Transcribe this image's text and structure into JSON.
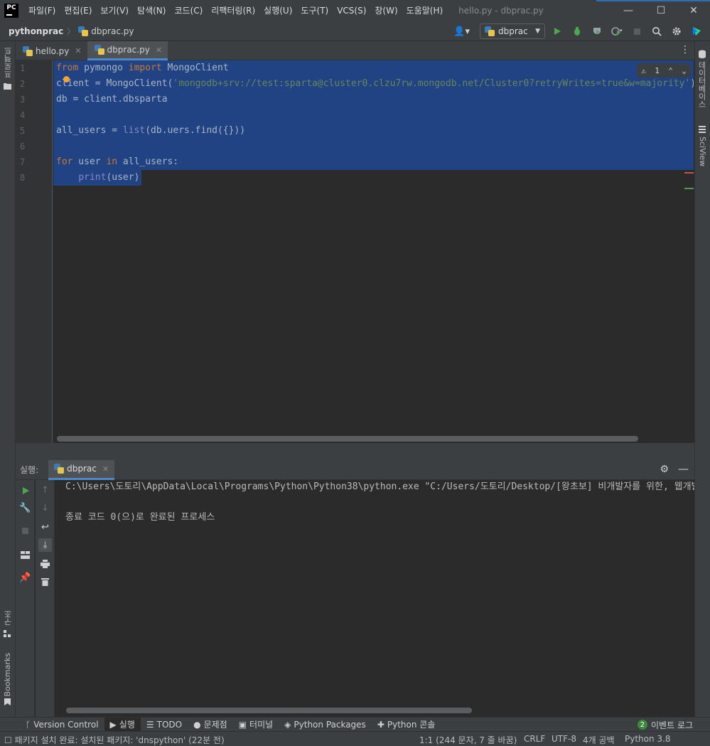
{
  "app": {
    "logo_text": "PC",
    "window_title": "hello.py - dbprac.py"
  },
  "menu": [
    "파일(F)",
    "편집(E)",
    "보기(V)",
    "탐색(N)",
    "코드(C)",
    "리팩터링(R)",
    "실행(U)",
    "도구(T)",
    "VCS(S)",
    "창(W)",
    "도움말(H)"
  ],
  "window_controls": {
    "minimize": "—",
    "maximize": "☐",
    "close": "✕"
  },
  "navbar": {
    "project": "pythonprac",
    "file": "dbprac.py",
    "run_config": "dbprac"
  },
  "left_strip": {
    "project_label": "프로젝트",
    "structure_label": "구조",
    "bookmarks_label": "Bookmarks"
  },
  "right_strip": {
    "database_label": "데이터베이스",
    "sciview_label": "SciView"
  },
  "editor_tabs": [
    {
      "label": "hello.py",
      "active": false
    },
    {
      "label": "dbprac.py",
      "active": true
    }
  ],
  "inspection": {
    "warnings": "1"
  },
  "code_lines": [
    {
      "n": "1",
      "segments": [
        {
          "t": "from",
          "c": "kw"
        },
        {
          "t": " pymongo ",
          "c": ""
        },
        {
          "t": "import",
          "c": "kw"
        },
        {
          "t": " MongoClient",
          "c": ""
        }
      ]
    },
    {
      "n": "2",
      "segments": [
        {
          "t": "client = MongoClient(",
          "c": ""
        },
        {
          "t": "'mongodb+srv://test:sparta@cluster0.clzu7rw.mongodb.net/Cluster0?retryWrites=true&w=majority'",
          "c": "str"
        },
        {
          "t": ")",
          "c": ""
        }
      ]
    },
    {
      "n": "3",
      "segments": [
        {
          "t": "db = client.dbsparta",
          "c": ""
        }
      ]
    },
    {
      "n": "4",
      "segments": []
    },
    {
      "n": "5",
      "segments": [
        {
          "t": "all_users = ",
          "c": ""
        },
        {
          "t": "list",
          "c": "fn"
        },
        {
          "t": "(db.uers.find({}))",
          "c": ""
        }
      ]
    },
    {
      "n": "6",
      "segments": []
    },
    {
      "n": "7",
      "segments": [
        {
          "t": "for",
          "c": "kw"
        },
        {
          "t": " user ",
          "c": ""
        },
        {
          "t": "in",
          "c": "kw"
        },
        {
          "t": " all_users:",
          "c": ""
        }
      ]
    },
    {
      "n": "8",
      "segments": [
        {
          "t": "    ",
          "c": ""
        },
        {
          "t": "print",
          "c": "fn"
        },
        {
          "t": "(user)",
          "c": ""
        }
      ]
    }
  ],
  "run_panel": {
    "label": "실행:",
    "tab": "dbprac",
    "console_lines": [
      "C:\\Users\\도토리\\AppData\\Local\\Programs\\Python\\Python38\\python.exe \"C:/Users/도토리/Desktop/[왕초보] 비개발자를 위한, 웹개발 종합반 (프로그래밍 입문자 포함)/pythonprac/dbprac.py\"",
      "",
      "종료 코드 0(으)로 완료된 프로세스"
    ]
  },
  "tool_windows": [
    {
      "label": "Version Control",
      "icon": "branch-icon",
      "active": false
    },
    {
      "label": "실행",
      "icon": "run-icon",
      "active": true
    },
    {
      "label": "TODO",
      "icon": "list-icon",
      "active": false
    },
    {
      "label": "문제점",
      "icon": "problems-icon",
      "active": false
    },
    {
      "label": "터미널",
      "icon": "terminal-icon",
      "active": false
    },
    {
      "label": "Python Packages",
      "icon": "packages-icon",
      "active": false
    },
    {
      "label": "Python 콘솔",
      "icon": "python-console-icon",
      "active": false
    }
  ],
  "event_log": {
    "count": "2",
    "label": "이벤트 로그"
  },
  "status": {
    "message": "패키지 설치 완료: 설치된 패키지: 'dnspython' (22분 전)",
    "position": "1:1 (244 문자, 7 줄 바꿈)",
    "line_sep": "CRLF",
    "encoding": "UTF-8",
    "indent": "4개 공백",
    "interpreter": "Python 3.8"
  },
  "colors": {
    "selection": "#214283",
    "keyword": "#cc7832",
    "string": "#6a8759",
    "builtin": "#8888c6",
    "run_green": "#4ea64e",
    "accent": "#4a88c7"
  }
}
